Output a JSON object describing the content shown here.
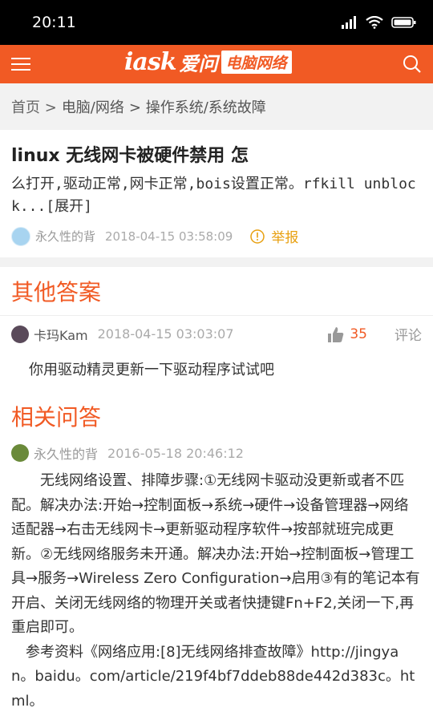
{
  "status": {
    "time": "20:11"
  },
  "appbar": {
    "logo_iask": "iask",
    "logo_aiwen": "爱问",
    "logo_channel": "电脑网络"
  },
  "breadcrumb": [
    "首页 >",
    "电脑/网络",
    "> 操作系统/系统故障"
  ],
  "question": {
    "title": "linux 无线网卡被硬件禁用 怎",
    "body": "么打开,驱动正常,网卡正常,bois设置正常。rfkill unblock...[展开]",
    "user": "永久性的背",
    "time": "2018-04-15 03:58:09",
    "report": "举报"
  },
  "other_answers": {
    "title": "其他答案",
    "user": "卡玛Kam",
    "time": "2018-04-15 03:03:07",
    "likes": "35",
    "comment": "评论",
    "body": "你用驱动精灵更新一下驱动程序试试吧"
  },
  "related": {
    "title": "相关问答",
    "user": "永久性的背",
    "time": "2016-05-18 20:46:12",
    "body": "无线网络设置、排障步骤:①无线网卡驱动没更新或者不匹配。解决办法:开始→控制面板→系统→硬件→设备管理器→网络适配器→右击无线网卡→更新驱动程序软件→按部就班完成更新。②无线网络服务未开通。解决办法:开始→控制面板→管理工具→服务→Wireless Zero Configuration→启用③有的笔记本有开启、关闭无线网络的物理开关或者快捷键Fn+F2,关闭一下,再重启即可。",
    "ref": "参考资料《网络应用:[8]无线网络排查故障》http://jingyan。baidu。com/article/219f4bf7ddeb88de442d383c。html。"
  },
  "colors": {
    "accent": "#f15a24",
    "report": "#e8a010"
  }
}
